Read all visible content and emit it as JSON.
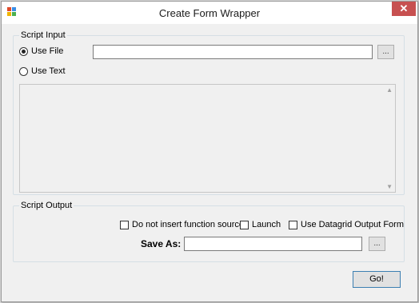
{
  "window": {
    "title": "Create Form Wrapper",
    "close_glyph": "✕"
  },
  "script_input": {
    "label": "Script Input",
    "use_file_label": "Use File",
    "use_text_label": "Use Text",
    "file_path_value": "",
    "browse_label": "...",
    "selected": "use_file"
  },
  "script_output": {
    "label": "Script Output",
    "options": [
      {
        "label": "Do not insert function source",
        "checked": false
      },
      {
        "label": "Launch",
        "checked": false
      },
      {
        "label": "Use Datagrid Output Form",
        "checked": false
      }
    ],
    "save_as_label": "Save As:",
    "save_as_value": "",
    "browse_label": "..."
  },
  "go_label": "Go!",
  "icons": {
    "app": "app-icon",
    "close": "close-icon",
    "scroll_up": "scroll-up-arrow-icon",
    "scroll_down": "scroll-down-arrow-icon"
  },
  "colors": {
    "close_button": "#c75050",
    "window_bg": "#f0f0f0",
    "title_bg": "#ffffff"
  }
}
